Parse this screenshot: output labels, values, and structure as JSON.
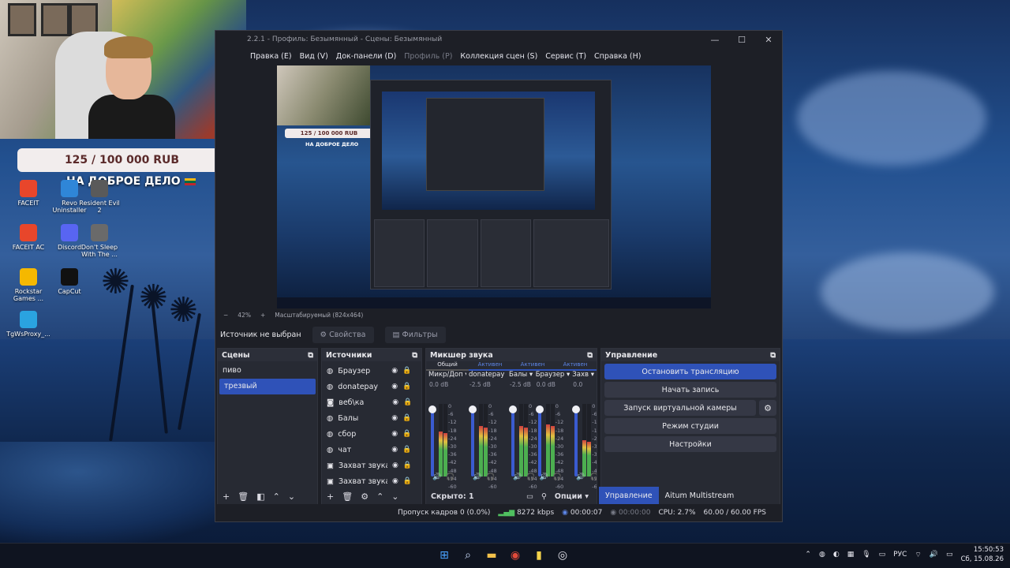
{
  "webcam_overlay": {
    "goal_text": "125 / 100 000 RUB",
    "goal_subtitle": "НА ДОБРОЕ ДЕЛО"
  },
  "desktop_icons": [
    {
      "label": "FACEIT",
      "icon": "faceit-icon",
      "color": "#e8462b"
    },
    {
      "label": "Revo Uninstaller",
      "icon": "revo-icon",
      "color": "#2f86d8"
    },
    {
      "label": "Resident Evil 2",
      "icon": "resident-evil-icon",
      "color": "#5a5a5a"
    },
    {
      "label": "FACEIT AC",
      "icon": "faceit-ac-icon",
      "color": "#e8462b"
    },
    {
      "label": "Discord",
      "icon": "discord-icon",
      "color": "#5865f2"
    },
    {
      "label": "Don't Sleep With The ...",
      "icon": "game-icon",
      "color": "#6a6a6a"
    },
    {
      "label": "Rockstar Games ...",
      "icon": "rockstar-icon",
      "color": "#f5b800"
    },
    {
      "label": "CapCut",
      "icon": "capcut-icon",
      "color": "#111111"
    },
    {
      "label": "TgWsProxy_...",
      "icon": "telegram-proxy-icon",
      "color": "#2aa3e0"
    }
  ],
  "obs": {
    "title": "2.2.1 - Профиль: Безымянный - Сцены: Безымянный",
    "menu": [
      {
        "label": "Правка (E)",
        "disabled": false
      },
      {
        "label": "Вид (V)",
        "disabled": false
      },
      {
        "label": "Док-панели (D)",
        "disabled": false
      },
      {
        "label": "Профиль (P)",
        "disabled": true
      },
      {
        "label": "Коллекция сцен (S)",
        "disabled": false
      },
      {
        "label": "Сервис (T)",
        "disabled": false
      },
      {
        "label": "Справка (H)",
        "disabled": false
      }
    ],
    "preview": {
      "goal_text": "125 / 100 000 RUB",
      "goal_subtitle": "НА ДОБРОЕ ДЕЛО"
    },
    "zoom": {
      "minus": "−",
      "value": "42%",
      "plus": "+",
      "mode": "Масштабируемый (824x464)"
    },
    "source_bar": {
      "label": "Источник не выбран",
      "properties": "Свойства",
      "filters": "Фильтры"
    },
    "scenes": {
      "title": "Сцены",
      "items": [
        {
          "label": "пиво",
          "selected": false
        },
        {
          "label": "трезвый",
          "selected": true
        }
      ]
    },
    "sources": {
      "title": "Источники",
      "items": [
        {
          "label": "Браузер",
          "icon": "globe-icon"
        },
        {
          "label": "donatepay",
          "icon": "globe-icon"
        },
        {
          "label": "веб\\ка",
          "icon": "camera-icon"
        },
        {
          "label": "Балы",
          "icon": "globe-icon"
        },
        {
          "label": "сбор",
          "icon": "globe-icon"
        },
        {
          "label": "чат",
          "icon": "globe-icon"
        },
        {
          "label": "Захват звука п",
          "icon": "window-icon"
        },
        {
          "label": "Захват звука п",
          "icon": "window-icon"
        }
      ]
    },
    "mixer": {
      "title": "Микшер звука",
      "tabs": [
        "Общий",
        "Активен",
        "Активен",
        "Активен"
      ],
      "channels": [
        {
          "name": "Микр/Доп",
          "db": "0.0 dB",
          "level": 0.62
        },
        {
          "name": "donatepay",
          "db": "-2.5 dB",
          "level": 0.7
        },
        {
          "name": "Балы",
          "db": "-2.5 dB",
          "level": 0.7
        },
        {
          "name": "Браузер",
          "db": "0.0 dB",
          "level": 0.72
        },
        {
          "name": "Захв",
          "db": "0.0",
          "level": 0.5
        }
      ],
      "scale": [
        "0",
        "-6",
        "-12",
        "-18",
        "-24",
        "-30",
        "-36",
        "-42",
        "-48",
        "-54",
        "-60"
      ],
      "hidden_label": "Скрыто: 1",
      "options_label": "Опции"
    },
    "controls": {
      "title": "Управление",
      "stop_stream": "Остановить трансляцию",
      "start_record": "Начать запись",
      "virtual_camera": "Запуск виртуальной камеры",
      "studio_mode": "Режим студии",
      "settings": "Настройки"
    },
    "bottom_tabs": {
      "active": "Управление",
      "other": "Aitum Multistream"
    },
    "status": {
      "dropped_frames": "Пропуск кадров 0 (0.0%)",
      "bitrate": "8272 kbps",
      "stream_time": "00:00:07",
      "record_time": "00:00:00",
      "cpu": "CPU: 2.7%",
      "fps": "60.00 / 60.00 FPS"
    }
  },
  "taskbar": {
    "language": "РУС",
    "time": "15:50:53",
    "date": "Сб, 15.08.26"
  }
}
